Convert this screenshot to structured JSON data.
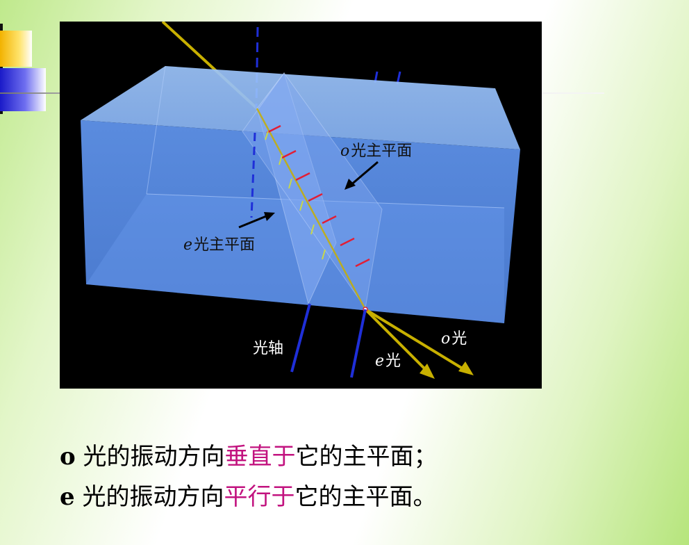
{
  "figure": {
    "labels": {
      "o_plane_prefix": "o",
      "o_plane_text": "光主平面",
      "e_plane_prefix": "e",
      "e_plane_text": "光主平面",
      "optic_axis": "光轴",
      "e_ray_prefix": "e",
      "e_ray_text": "光",
      "o_ray_prefix": "o",
      "o_ray_text": "光"
    },
    "colors": {
      "background": "#000000",
      "crystal": "#5b8de6",
      "ray": "#c8b000",
      "optic_axis": "#1f2fd8",
      "o_vibration": "#e21e35",
      "e_vibration": "#c8d84a"
    }
  },
  "caption": {
    "line1": {
      "prefix": "o",
      "before": " 光的振动方向",
      "emphasis": "垂直于",
      "after": "它的主平面；"
    },
    "line2": {
      "prefix": "e",
      "before": " 光的振动方向",
      "emphasis": "平行于",
      "after": "它的主平面。"
    },
    "emphasis_color": "#c2137f"
  }
}
